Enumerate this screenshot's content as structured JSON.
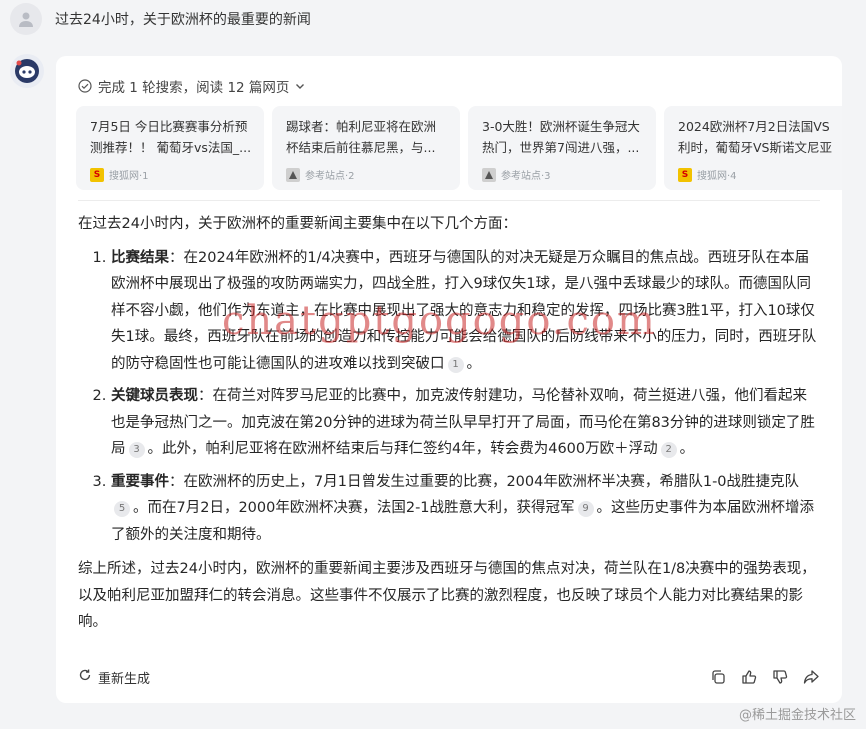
{
  "user": {
    "question": "过去24小时，关于欧洲杯的最重要的新闻"
  },
  "search_status": {
    "label": "完成 1 轮搜索，阅读 12 篇网页"
  },
  "sources": [
    {
      "title": "7月5日 今日比赛赛事分析预测推荐！！ 葡萄牙vs法国_...",
      "site": "搜狐网·1",
      "icon": "sohu-logo"
    },
    {
      "title": "踢球者：帕利尼亚将在欧洲杯结束后前往慕尼黑，与...",
      "site": "参考站点·2",
      "icon": "reference-icon"
    },
    {
      "title": "3-0大胜！欧洲杯诞生争冠大热门，世界第7闯进八强，...",
      "site": "参考站点·3",
      "icon": "reference-icon"
    },
    {
      "title": "2024欧洲杯7月2日法国VS利时，葡萄牙VS斯诺文尼亚",
      "site": "搜狐网·4",
      "icon": "sohu-logo"
    }
  ],
  "answer": {
    "intro": "在过去24小时内，关于欧洲杯的重要新闻主要集中在以下几个方面：",
    "items": [
      {
        "title": "比赛结果",
        "text": "：在2024年欧洲杯的1/4决赛中，西班牙与德国队的对决无疑是万众瞩目的焦点战。西班牙队在本届欧洲杯中展现出了极强的攻防两端实力，四战全胜，打入9球仅失1球，是八强中丢球最少的球队。而德国队同样不容小觑，他们作为东道主，在比赛中展现出了强大的意志力和稳定的发挥，四场比赛3胜1平，打入10球仅失1球。最终，西班牙队在前场的创造力和传控能力可能会给德国队的后防线带来不小的压力，同时，西班牙队的防守稳固性也可能让德国队的进攻难以找到突破口",
        "cites": [
          "1"
        ]
      },
      {
        "title": "关键球员表现",
        "text": "：在荷兰对阵罗马尼亚的比赛中，加克波传射建功，马伦替补双响，荷兰挺进八强，他们看起来也是争冠热门之一。加克波在第20分钟的进球为荷兰队早早打开了局面，而马伦在第83分钟的进球则锁定了胜局",
        "cite_a": "3",
        "text_b": "。此外，帕利尼亚将在欧洲杯结束后与拜仁签约4年，转会费为4600万欧＋浮动",
        "cite_b": "2",
        "tail": "。"
      },
      {
        "title": "重要事件",
        "text": "：在欧洲杯的历史上，7月1日曾发生过重要的比赛，2004年欧洲杯半决赛，希腊队1-0战胜捷克队",
        "cite_a": "5",
        "text_b": "。而在7月2日，2000年欧洲杯决赛，法国2-1战胜意大利，获得冠军",
        "cite_b": "9",
        "tail": "。这些历史事件为本届欧洲杯增添了额外的关注度和期待。"
      }
    ],
    "summary": "综上所述，过去24小时内，欧洲杯的重要新闻主要涉及西班牙与德国的焦点对决，荷兰队在1/8决赛中的强势表现，以及帕利尼亚加盟拜仁的转会消息。这些事件不仅展示了比赛的激烈程度，也反映了球员个人能力对比赛结果的影响。"
  },
  "footer": {
    "regenerate": "重新生成"
  },
  "watermark": "chatgptgogogo.com",
  "corner_watermark": "@稀土掘金技术社区"
}
